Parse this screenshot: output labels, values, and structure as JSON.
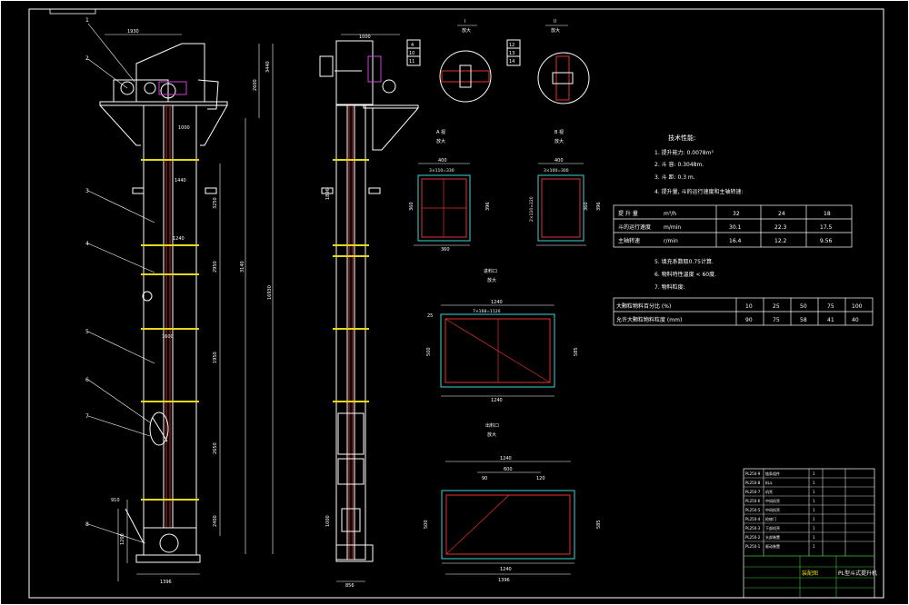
{
  "drawing": {
    "leader_numbers": [
      "1",
      "2",
      "3",
      "4",
      "5",
      "6",
      "7",
      "8"
    ],
    "main_view": {
      "dims": [
        "1930",
        "3440",
        "3250",
        "1950",
        "2650",
        "2950",
        "2400",
        "3140",
        "910",
        "1200",
        "1396",
        "2600",
        "1440",
        "1000",
        "1240",
        "1600",
        "16930"
      ]
    },
    "side_view": {
      "dims": [
        "1000",
        "1896",
        "1000",
        "856"
      ]
    },
    "details": [
      {
        "roman": "I",
        "scale": "放大",
        "tags": [
          "4",
          "10",
          "11"
        ]
      },
      {
        "roman": "II",
        "scale": "放大",
        "tags": [
          "12",
          "13",
          "14"
        ]
      }
    ],
    "sections": [
      {
        "title": "A 视",
        "scale": "放大",
        "dims": [
          "400",
          "3×110=330",
          "360",
          "396",
          "360"
        ]
      },
      {
        "title": "B 视",
        "scale": "放大",
        "dims": [
          "400",
          "3×100=300",
          "396",
          "360",
          "2×110=220"
        ]
      },
      {
        "title": "进料口",
        "scale": "放大",
        "dims": [
          "1240",
          "7×168=1120",
          "25",
          "1240",
          "500",
          "585"
        ]
      },
      {
        "title": "出料口",
        "scale": "放大",
        "dims": [
          "1240",
          "600",
          "90",
          "120",
          "1396",
          "1240",
          "500",
          "585"
        ]
      }
    ]
  },
  "tech": {
    "title": "技术性能:",
    "items": [
      "1. 提升能力: 0.0078m³",
      "2. 斗 容: 0.3048m.",
      "3. 斗 距: 0.3 m.",
      "4. 提升量, 斗的运行速度和主轴转速:"
    ],
    "table1": [
      {
        "label": "提 升 量",
        "unit": "m³/h",
        "values": [
          "32",
          "24",
          "18"
        ]
      },
      {
        "label": "斗的运行速度",
        "unit": "m/min",
        "values": [
          "30.1",
          "22.3",
          "17.5"
        ]
      },
      {
        "label": "主轴转速",
        "unit": "r/min",
        "values": [
          "16.4",
          "12.2",
          "9.56"
        ]
      }
    ],
    "items2": [
      "5. 填充系数取0.75计算.",
      "6. 物料特性温度 < 60度.",
      "7. 物料粒度:"
    ],
    "table2": [
      {
        "label": "大颗粒物料百分比 (%)",
        "values": [
          "10",
          "25",
          "50",
          "75",
          "100"
        ]
      },
      {
        "label": "允许大颗粒物料粒度 (mm)",
        "values": [
          "90",
          "75",
          "58",
          "41",
          "40"
        ]
      }
    ]
  },
  "title_block": {
    "bom_rows": [
      {
        "code": "PL250-9",
        "name": "链条组件",
        "qty": "1"
      },
      {
        "code": "PL250-8",
        "name": "料斗",
        "qty": "1"
      },
      {
        "code": "PL250-7",
        "name": "机壳",
        "qty": "1"
      },
      {
        "code": "PL250-6",
        "name": "中间机壳",
        "qty": "1"
      },
      {
        "code": "PL250-5",
        "name": "中间机壳",
        "qty": "1"
      },
      {
        "code": "PL250-4",
        "name": "检修门",
        "qty": "1"
      },
      {
        "code": "PL250-3",
        "name": "下部机壳",
        "qty": "1"
      },
      {
        "code": "PL250-2",
        "name": "头部装置",
        "qty": "1"
      },
      {
        "code": "PL250-1",
        "name": "驱动装置",
        "qty": "1"
      }
    ],
    "drawing_name": "PL型斗式提升机",
    "company": "装配图"
  }
}
